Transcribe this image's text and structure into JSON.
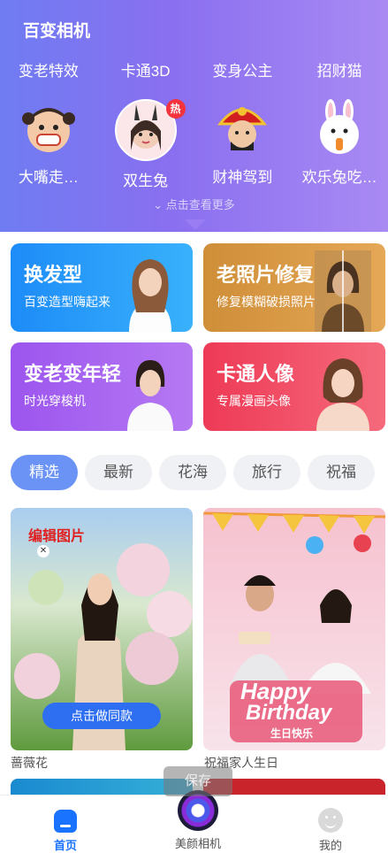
{
  "app_title": "百变相机",
  "effects_row1": [
    "变老特效",
    "卡通3D",
    "变身公主",
    "招财猫"
  ],
  "effects_row2": [
    {
      "label": "大嘴走…",
      "icon": "bigmouth-face-icon"
    },
    {
      "label": "双生兔",
      "icon": "bunny-ears-portrait-icon",
      "badge": "热"
    },
    {
      "label": "财神驾到",
      "icon": "god-of-wealth-icon"
    },
    {
      "label": "欢乐兔吃…",
      "icon": "happy-rabbit-icon"
    }
  ],
  "see_more": "点击查看更多",
  "feature_cards": [
    {
      "title": "换发型",
      "subtitle": "百变造型嗨起来",
      "color": "#2f8ff5"
    },
    {
      "title": "老照片修复",
      "subtitle": "修复模糊破损照片",
      "color": "#d89a41"
    },
    {
      "title": "变老变年轻",
      "subtitle": "时光穿梭机",
      "color": "#a05bee"
    },
    {
      "title": "卡通人像",
      "subtitle": "专属漫画头像",
      "color": "#f04a63"
    }
  ],
  "tabs": [
    {
      "label": "精选",
      "active": true
    },
    {
      "label": "最新",
      "active": false
    },
    {
      "label": "花海",
      "active": false
    },
    {
      "label": "旅行",
      "active": false
    },
    {
      "label": "祝福",
      "active": false
    }
  ],
  "templates": [
    {
      "caption": "蔷薇花",
      "edit_tag": "编辑图片",
      "action": "点击做同款"
    },
    {
      "caption": "祝福家人生日",
      "art_line1": "Happy",
      "art_line2": "Birthday",
      "art_line3": "生日快乐"
    }
  ],
  "save_label": "保存",
  "bottom_nav": [
    {
      "label": "首页",
      "active": true
    },
    {
      "label": "美颜相机",
      "active": false
    },
    {
      "label": "我的",
      "active": false
    }
  ]
}
